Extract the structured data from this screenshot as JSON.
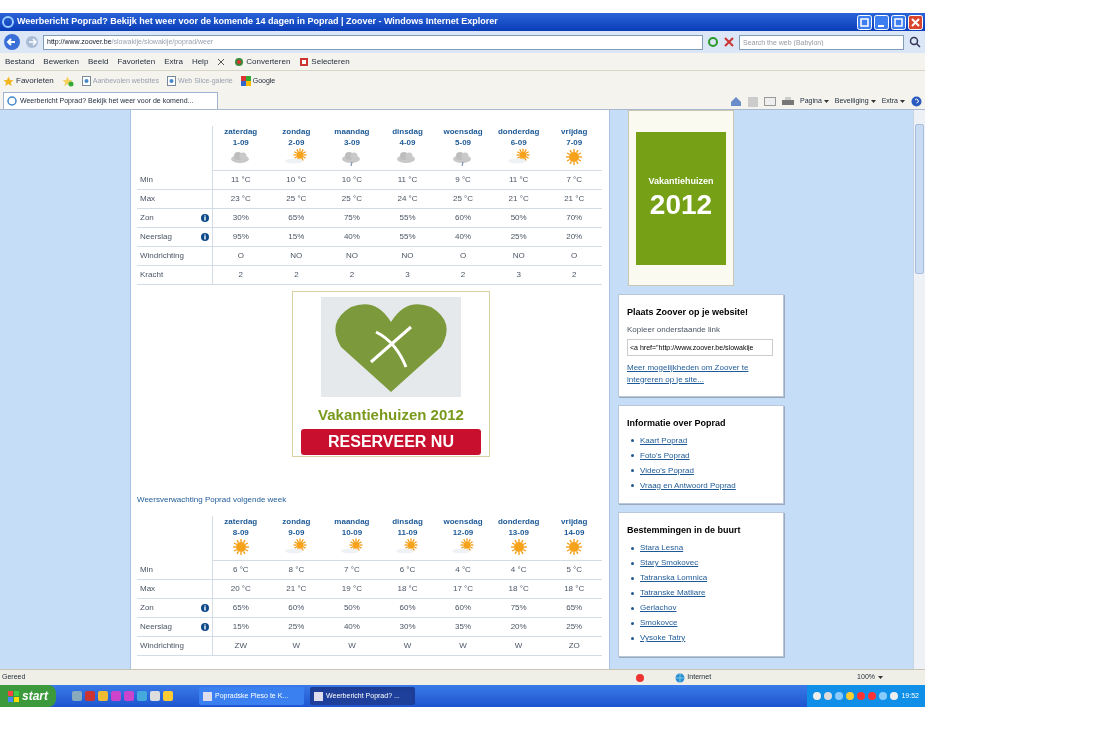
{
  "window": {
    "title": "Weerbericht Poprad? Bekijk het weer voor de komende 14 dagen in Poprad | Zoover - Windows Internet Explorer"
  },
  "address_bar": {
    "url_host": "http://www.zoover.be",
    "url_path": "/slowakije/slowakije/poprad/weer",
    "search_placeholder": "Search the web (Babylon)"
  },
  "menu": [
    "Bestand",
    "Bewerken",
    "Beeld",
    "Favorieten",
    "Extra",
    "Help"
  ],
  "toolbar": [
    "Converteren",
    "Selecteren"
  ],
  "favorites_bar": {
    "label": "Favorieten",
    "items": [
      "Aanbevolen websites",
      "Web Slice-galerie",
      "Google"
    ]
  },
  "tab": {
    "title": "Weerbericht Poprad? Bekijk het weer voor de komend..."
  },
  "command_bar": [
    "Pagina",
    "Beveiliging",
    "Extra"
  ],
  "forecasts": [
    {
      "days": [
        {
          "day": "zaterdag",
          "date": "1-09",
          "kind": "cloudy"
        },
        {
          "day": "zondag",
          "date": "2-09",
          "kind": "partly"
        },
        {
          "day": "maandag",
          "date": "3-09",
          "kind": "rain"
        },
        {
          "day": "dinsdag",
          "date": "4-09",
          "kind": "cloudy"
        },
        {
          "day": "woensdag",
          "date": "5-09",
          "kind": "rain"
        },
        {
          "day": "donderdag",
          "date": "6-09",
          "kind": "partly"
        },
        {
          "day": "vrijdag",
          "date": "7-09",
          "kind": "sunny"
        }
      ],
      "rows": [
        {
          "label": "Min",
          "info": false,
          "values": [
            "11 °C",
            "10 °C",
            "10 °C",
            "11 °C",
            "9 °C",
            "11 °C",
            "7 °C"
          ]
        },
        {
          "label": "Max",
          "info": false,
          "values": [
            "23 °C",
            "25 °C",
            "25 °C",
            "24 °C",
            "25 °C",
            "21 °C",
            "21 °C"
          ]
        },
        {
          "label": "Zon",
          "info": true,
          "values": [
            "30%",
            "65%",
            "75%",
            "55%",
            "60%",
            "50%",
            "70%"
          ]
        },
        {
          "label": "Neerslag",
          "info": true,
          "values": [
            "95%",
            "15%",
            "40%",
            "55%",
            "40%",
            "25%",
            "20%"
          ]
        },
        {
          "label": "Windrichting",
          "info": false,
          "values": [
            "O",
            "NO",
            "NO",
            "NO",
            "O",
            "NO",
            "O"
          ]
        },
        {
          "label": "Kracht",
          "info": false,
          "values": [
            "2",
            "2",
            "2",
            "3",
            "2",
            "3",
            "2"
          ]
        }
      ]
    },
    {
      "heading": "Weersverwachting Poprad volgende week",
      "days": [
        {
          "day": "zaterdag",
          "date": "8-09",
          "kind": "sunny"
        },
        {
          "day": "zondag",
          "date": "9-09",
          "kind": "partly"
        },
        {
          "day": "maandag",
          "date": "10-09",
          "kind": "partly"
        },
        {
          "day": "dinsdag",
          "date": "11-09",
          "kind": "partly"
        },
        {
          "day": "woensdag",
          "date": "12-09",
          "kind": "partly"
        },
        {
          "day": "donderdag",
          "date": "13-09",
          "kind": "sunny"
        },
        {
          "day": "vrijdag",
          "date": "14-09",
          "kind": "sunny"
        }
      ],
      "rows": [
        {
          "label": "Min",
          "info": false,
          "values": [
            "6 °C",
            "8 °C",
            "7 °C",
            "6 °C",
            "4 °C",
            "4 °C",
            "5 °C"
          ]
        },
        {
          "label": "Max",
          "info": false,
          "values": [
            "20 °C",
            "21 °C",
            "19 °C",
            "18 °C",
            "17 °C",
            "18 °C",
            "18 °C"
          ]
        },
        {
          "label": "Zon",
          "info": true,
          "values": [
            "65%",
            "60%",
            "50%",
            "60%",
            "60%",
            "75%",
            "65%"
          ]
        },
        {
          "label": "Neerslag",
          "info": true,
          "values": [
            "15%",
            "25%",
            "40%",
            "30%",
            "35%",
            "20%",
            "25%"
          ]
        },
        {
          "label": "Windrichting",
          "info": false,
          "values": [
            "ZW",
            "W",
            "W",
            "W",
            "W",
            "W",
            "ZO"
          ]
        }
      ]
    }
  ],
  "ad": {
    "headline": "Vakantiehuizen 2012",
    "button": "RESERVEER NU"
  },
  "sidebar": {
    "banner": {
      "label": "Vakantiehuizen",
      "year": "2012"
    },
    "embed_box": {
      "title": "Plaats Zoover op je website!",
      "label": "Kopieer onderstaande link",
      "code": "<a href=\"http://www.zoover.be/slowakije",
      "link": "Meer mogelijkheden om Zoover te integreren op je site..."
    },
    "info_box": {
      "title": "Informatie over Poprad",
      "links": [
        "Kaart Poprad",
        "Foto's Poprad",
        "Video's Poprad",
        "Vraag en Antwoord Poprad"
      ]
    },
    "nearby_box": {
      "title": "Bestemmingen in de buurt",
      "links": [
        "Stara Lesna",
        "Stary Smokovec",
        "Tatranska Lomnica",
        "Tatranske Matliare",
        "Gerlachov",
        "Smokovce",
        "Vysoke Tatry"
      ]
    }
  },
  "status_bar": {
    "text": "Gereed",
    "zone": "Internet",
    "zoom": "100%"
  },
  "taskbar": {
    "start": "start",
    "tasks": [
      {
        "label": "Popradske Pleso te K...",
        "selected": false
      },
      {
        "label": "Weerbericht Poprad? ...",
        "selected": true
      }
    ],
    "clock": "19:52"
  }
}
